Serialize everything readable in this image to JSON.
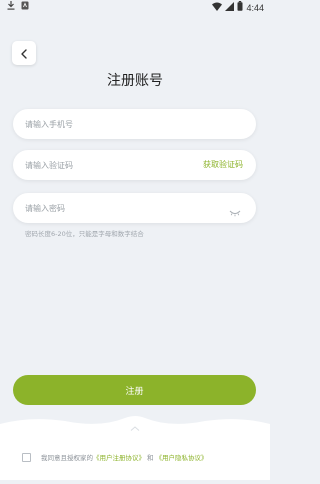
{
  "status_bar": {
    "time": "4:44"
  },
  "page": {
    "title": "注册账号"
  },
  "form": {
    "phone_placeholder": "请输入手机号",
    "code_placeholder": "请输入验证码",
    "get_code_label": "获取验证码",
    "password_placeholder": "请输入密码",
    "password_hint": "密码长度6-20位，只能是字母和数字结合",
    "register_label": "注册"
  },
  "agreement": {
    "prefix": "我同意且授权家的",
    "user_agreement": "《用户注册协议》",
    "and": "和",
    "privacy_policy": "《用户隐私协议》"
  },
  "colors": {
    "accent": "#8cb32a",
    "background": "#eef1f5"
  },
  "icons": {
    "status_left": [
      "download-icon",
      "app-notification-icon"
    ],
    "status_right": [
      "wifi-icon",
      "signal-icon",
      "battery-icon"
    ],
    "back": "chevron-left-icon",
    "password_toggle": "eye-closed-icon"
  }
}
